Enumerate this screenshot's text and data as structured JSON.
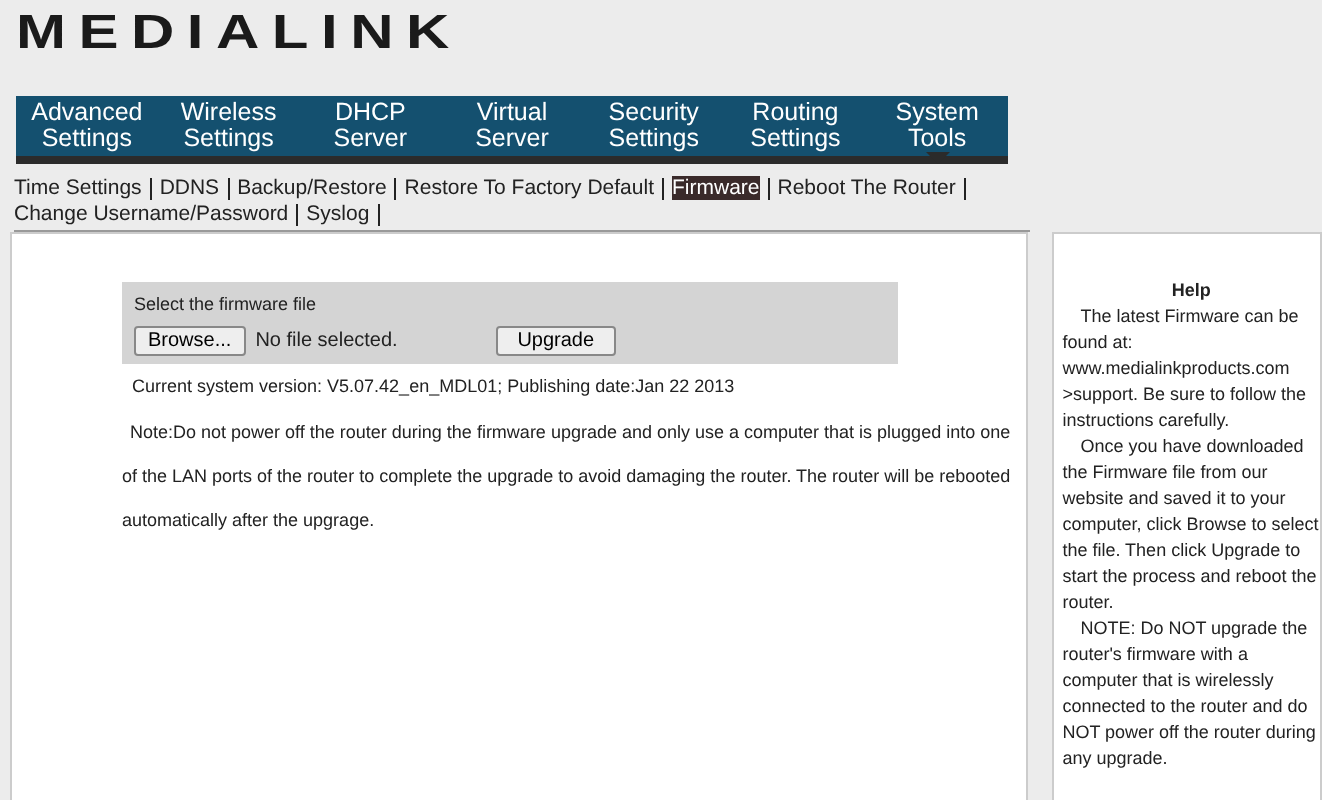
{
  "logo": "MEDIALINK",
  "nav": [
    {
      "label": "Advanced Settings",
      "selected": false
    },
    {
      "label": "Wireless Settings",
      "selected": false
    },
    {
      "label": "DHCP Server",
      "selected": false
    },
    {
      "label": "Virtual Server",
      "selected": false
    },
    {
      "label": "Security Settings",
      "selected": false
    },
    {
      "label": "Routing Settings",
      "selected": false
    },
    {
      "label": "System Tools",
      "selected": true
    }
  ],
  "subnav": [
    {
      "label": "Time Settings",
      "selected": false
    },
    {
      "label": "DDNS",
      "selected": false
    },
    {
      "label": "Backup/Restore",
      "selected": false
    },
    {
      "label": "Restore To Factory Default",
      "selected": false
    },
    {
      "label": "Firmware",
      "selected": true
    },
    {
      "label": "Reboot The Router",
      "selected": false
    },
    {
      "label": "Change Username/Password",
      "selected": false
    },
    {
      "label": "Syslog",
      "selected": false
    }
  ],
  "form": {
    "title": "Select the firmware file",
    "browse_button": "Browse...",
    "file_status": "No file selected.",
    "upgrade_button": "Upgrade"
  },
  "version": "Current system version: V5.07.42_en_MDL01; Publishing date:Jan 22 2013",
  "note": "Note:Do not power off the router during the firmware upgrade and only use a computer that is plugged into one of the LAN ports of the router to complete the upgrade to avoid damaging the router. The router will be rebooted automatically after the upgrage.",
  "help": {
    "title": "Help",
    "paragraphs": [
      "The latest Firmware can be found at: www.medialinkproducts.com >support. Be sure to follow the instructions carefully.",
      "Once you have downloaded the Firmware file from our website and saved it to your computer, click Browse to select the file. Then click Upgrade to start the process and reboot the router.",
      "NOTE: Do NOT upgrade the router's firmware with a computer that is wirelessly connected to the router and do NOT power off the router during any upgrade."
    ]
  }
}
